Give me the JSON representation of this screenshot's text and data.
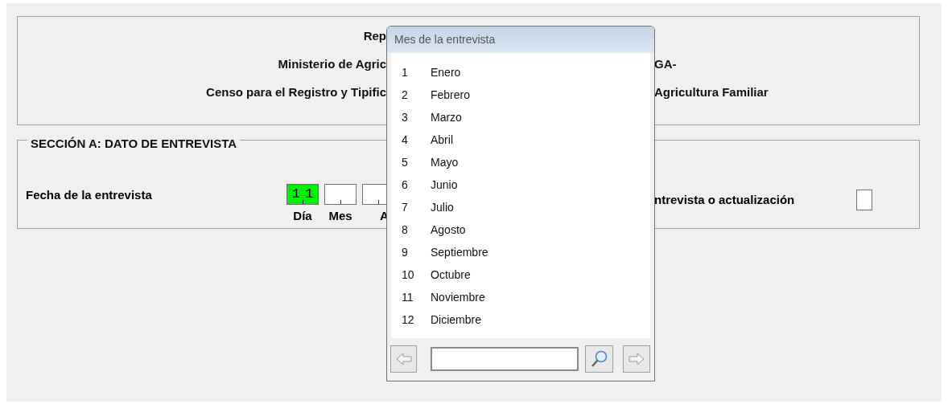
{
  "header": {
    "lines": [
      {
        "left": "Rep"
      },
      {
        "left": "Ministerio de Agric",
        "right": "GA-"
      },
      {
        "left": "Censo para el Registro y Tipific",
        "right": "Agricultura Familiar"
      }
    ]
  },
  "section": {
    "title": "SECCIÓN A: DATO DE ENTREVISTA",
    "date_label": "Fecha de la entrevista",
    "date_fields": [
      {
        "label": "Día",
        "value": "11",
        "highlighted": true
      },
      {
        "label": "Mes",
        "highlighted": false
      },
      {
        "label": "A",
        "highlighted": false
      }
    ],
    "update_label": "ntrevista o actualización",
    "update_checked": false
  },
  "popup": {
    "title": "Mes de la entrevista",
    "items": [
      {
        "number": "1",
        "label": "Enero"
      },
      {
        "number": "2",
        "label": "Febrero"
      },
      {
        "number": "3",
        "label": "Marzo"
      },
      {
        "number": "4",
        "label": "Abril"
      },
      {
        "number": "5",
        "label": "Mayo"
      },
      {
        "number": "6",
        "label": "Junio"
      },
      {
        "number": "7",
        "label": "Julio"
      },
      {
        "number": "8",
        "label": "Agosto"
      },
      {
        "number": "9",
        "label": "Septiembre"
      },
      {
        "number": "10",
        "label": "Octubre"
      },
      {
        "number": "11",
        "label": "Noviembre"
      },
      {
        "number": "12",
        "label": "Diciembre"
      }
    ]
  }
}
